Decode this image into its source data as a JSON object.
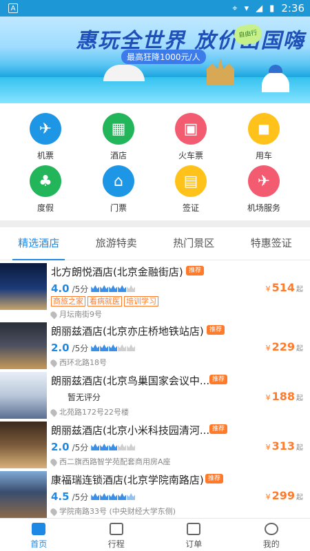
{
  "statusbar": {
    "time": "2:36",
    "app_letter": "A"
  },
  "banner": {
    "title": "惠玩全世界 放价出国嗨",
    "subtitle": "最高狂降1000元/人",
    "tag": "自由行"
  },
  "grid": [
    {
      "label": "机票",
      "color": "#1e96e6",
      "icon": "airplane-icon",
      "glyph": "✈"
    },
    {
      "label": "酒店",
      "color": "#22b55a",
      "icon": "hotel-icon",
      "glyph": "▦"
    },
    {
      "label": "火车票",
      "color": "#f25b70",
      "icon": "train-icon",
      "glyph": "🚆"
    },
    {
      "label": "用车",
      "color": "#ffc21a",
      "icon": "car-icon",
      "glyph": "🚗"
    },
    {
      "label": "度假",
      "color": "#22b55a",
      "icon": "palm-tree-icon",
      "glyph": "🌴"
    },
    {
      "label": "门票",
      "color": "#1e96e6",
      "icon": "temple-ticket-icon",
      "glyph": "⛩"
    },
    {
      "label": "签证",
      "color": "#ffc21a",
      "icon": "passport-icon",
      "glyph": "📘"
    },
    {
      "label": "机场服务",
      "color": "#f25b70",
      "icon": "airport-service-icon",
      "glyph": "✈"
    }
  ],
  "tabs": [
    "精选酒店",
    "旅游特卖",
    "热门景区",
    "特惠签证"
  ],
  "hotels": [
    {
      "name": "北方朗悦酒店(北京金融街店)",
      "rec": "推荐",
      "score": "4.0",
      "per": "/5分",
      "crowns": 4,
      "tags": [
        "商旅之家",
        "看病就医",
        "培训学习"
      ],
      "addr": "月坛南街9号",
      "price": "514",
      "yen": "¥",
      "qi": "起"
    },
    {
      "name": "朗丽兹酒店(北京亦庄桥地铁站店)",
      "rec": "推荐",
      "score": "2.0",
      "per": "/5分",
      "crowns": 3,
      "tags": [],
      "addr": "西环北路18号",
      "price": "229",
      "yen": "¥",
      "qi": "起"
    },
    {
      "name": "朗丽兹酒店(北京鸟巢国家会议中...",
      "rec": "推荐",
      "noscore": "暂无评分",
      "tags": [],
      "addr": "北苑路172号22号楼",
      "price": "188",
      "yen": "¥",
      "qi": "起"
    },
    {
      "name": "朗丽兹酒店(北京小米科技园清河...",
      "rec": "推荐",
      "score": "2.0",
      "per": "/5分",
      "crowns": 3,
      "tags": [],
      "addr": "西二旗西路智学苑配套商用房A座",
      "price": "313",
      "yen": "¥",
      "qi": "起"
    },
    {
      "name": "康福瑞连锁酒店(北京学院南路店)",
      "rec": "推荐",
      "score": "4.5",
      "per": "/5分",
      "crowns": 4,
      "tags": [],
      "addr": "学院南路33号 (中央财经大学东侧)",
      "price": "299",
      "yen": "¥",
      "qi": "起"
    }
  ],
  "bottom_nav": [
    {
      "label": "首页",
      "icon": "home-icon"
    },
    {
      "label": "行程",
      "icon": "briefcase-icon"
    },
    {
      "label": "订单",
      "icon": "order-icon"
    },
    {
      "label": "我的",
      "icon": "profile-icon"
    }
  ]
}
